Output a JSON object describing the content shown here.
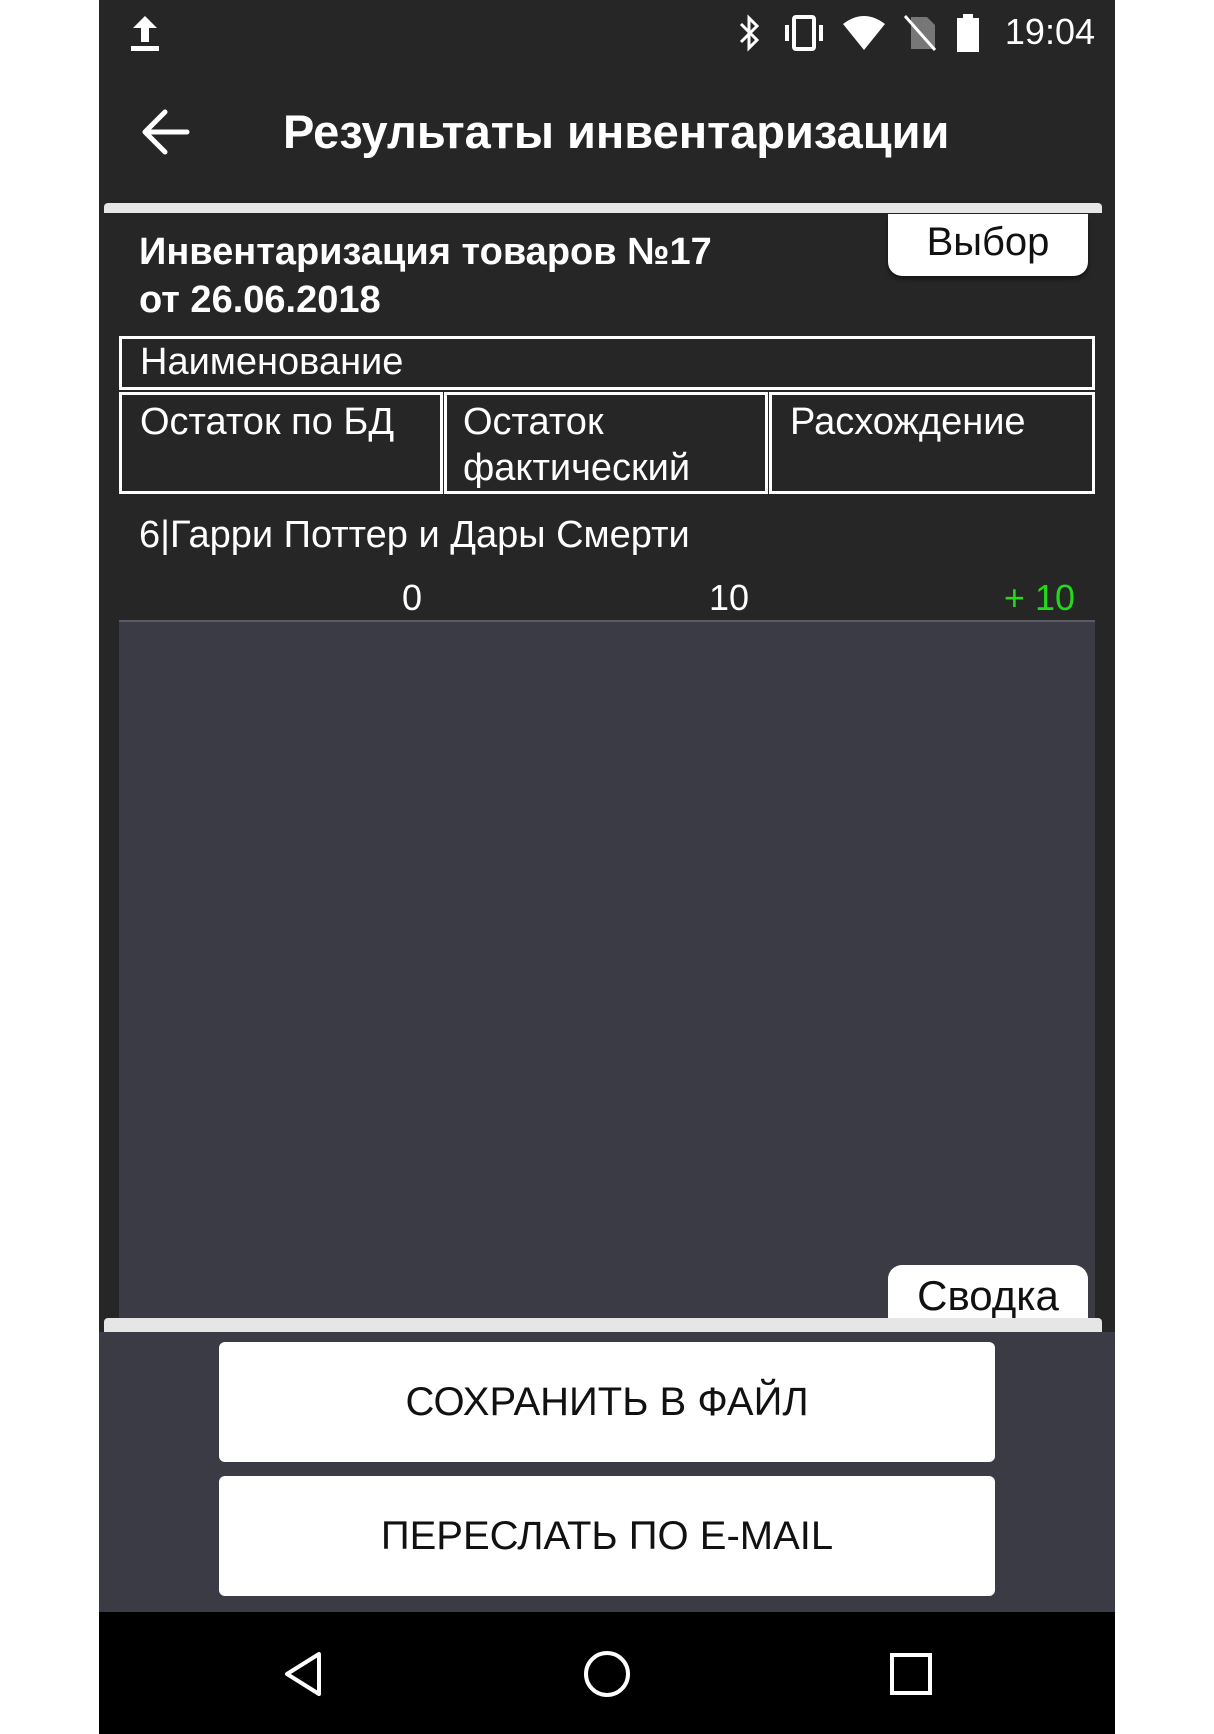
{
  "status_bar": {
    "time": "19:04",
    "icons": [
      "upload-icon",
      "bluetooth-icon",
      "vibrate-icon",
      "wifi-icon",
      "no-sim-icon",
      "battery-icon"
    ]
  },
  "header": {
    "title": "Результаты инвентаризации",
    "back_icon": "arrow-left-icon"
  },
  "document": {
    "title_line1": "Инвентаризация товаров №17",
    "title_line2": "от 26.06.2018",
    "select_label": "Выбор"
  },
  "table": {
    "columns": {
      "name": "Наименование",
      "db_stock": "Остаток по БД",
      "actual_stock_line1": "Остаток",
      "actual_stock_line2": "фактический",
      "difference": "Расхождение"
    },
    "rows": [
      {
        "name": "6|Гарри Поттер и Дары Смерти",
        "db_stock": "0",
        "actual_stock": "10",
        "difference": "+ 10"
      }
    ]
  },
  "summary_tab_label": "Сводка",
  "actions": {
    "save_label": "СОХРАНИТЬ В ФАЙЛ",
    "email_label": "ПЕРЕСЛАТЬ ПО E-MAIL"
  },
  "colors": {
    "background": "#262626",
    "panel": "#3b3b45",
    "positive_difference": "#23d91a"
  },
  "nav_bar": {
    "icons": [
      "back-triangle-icon",
      "home-circle-icon",
      "recents-square-icon"
    ]
  }
}
